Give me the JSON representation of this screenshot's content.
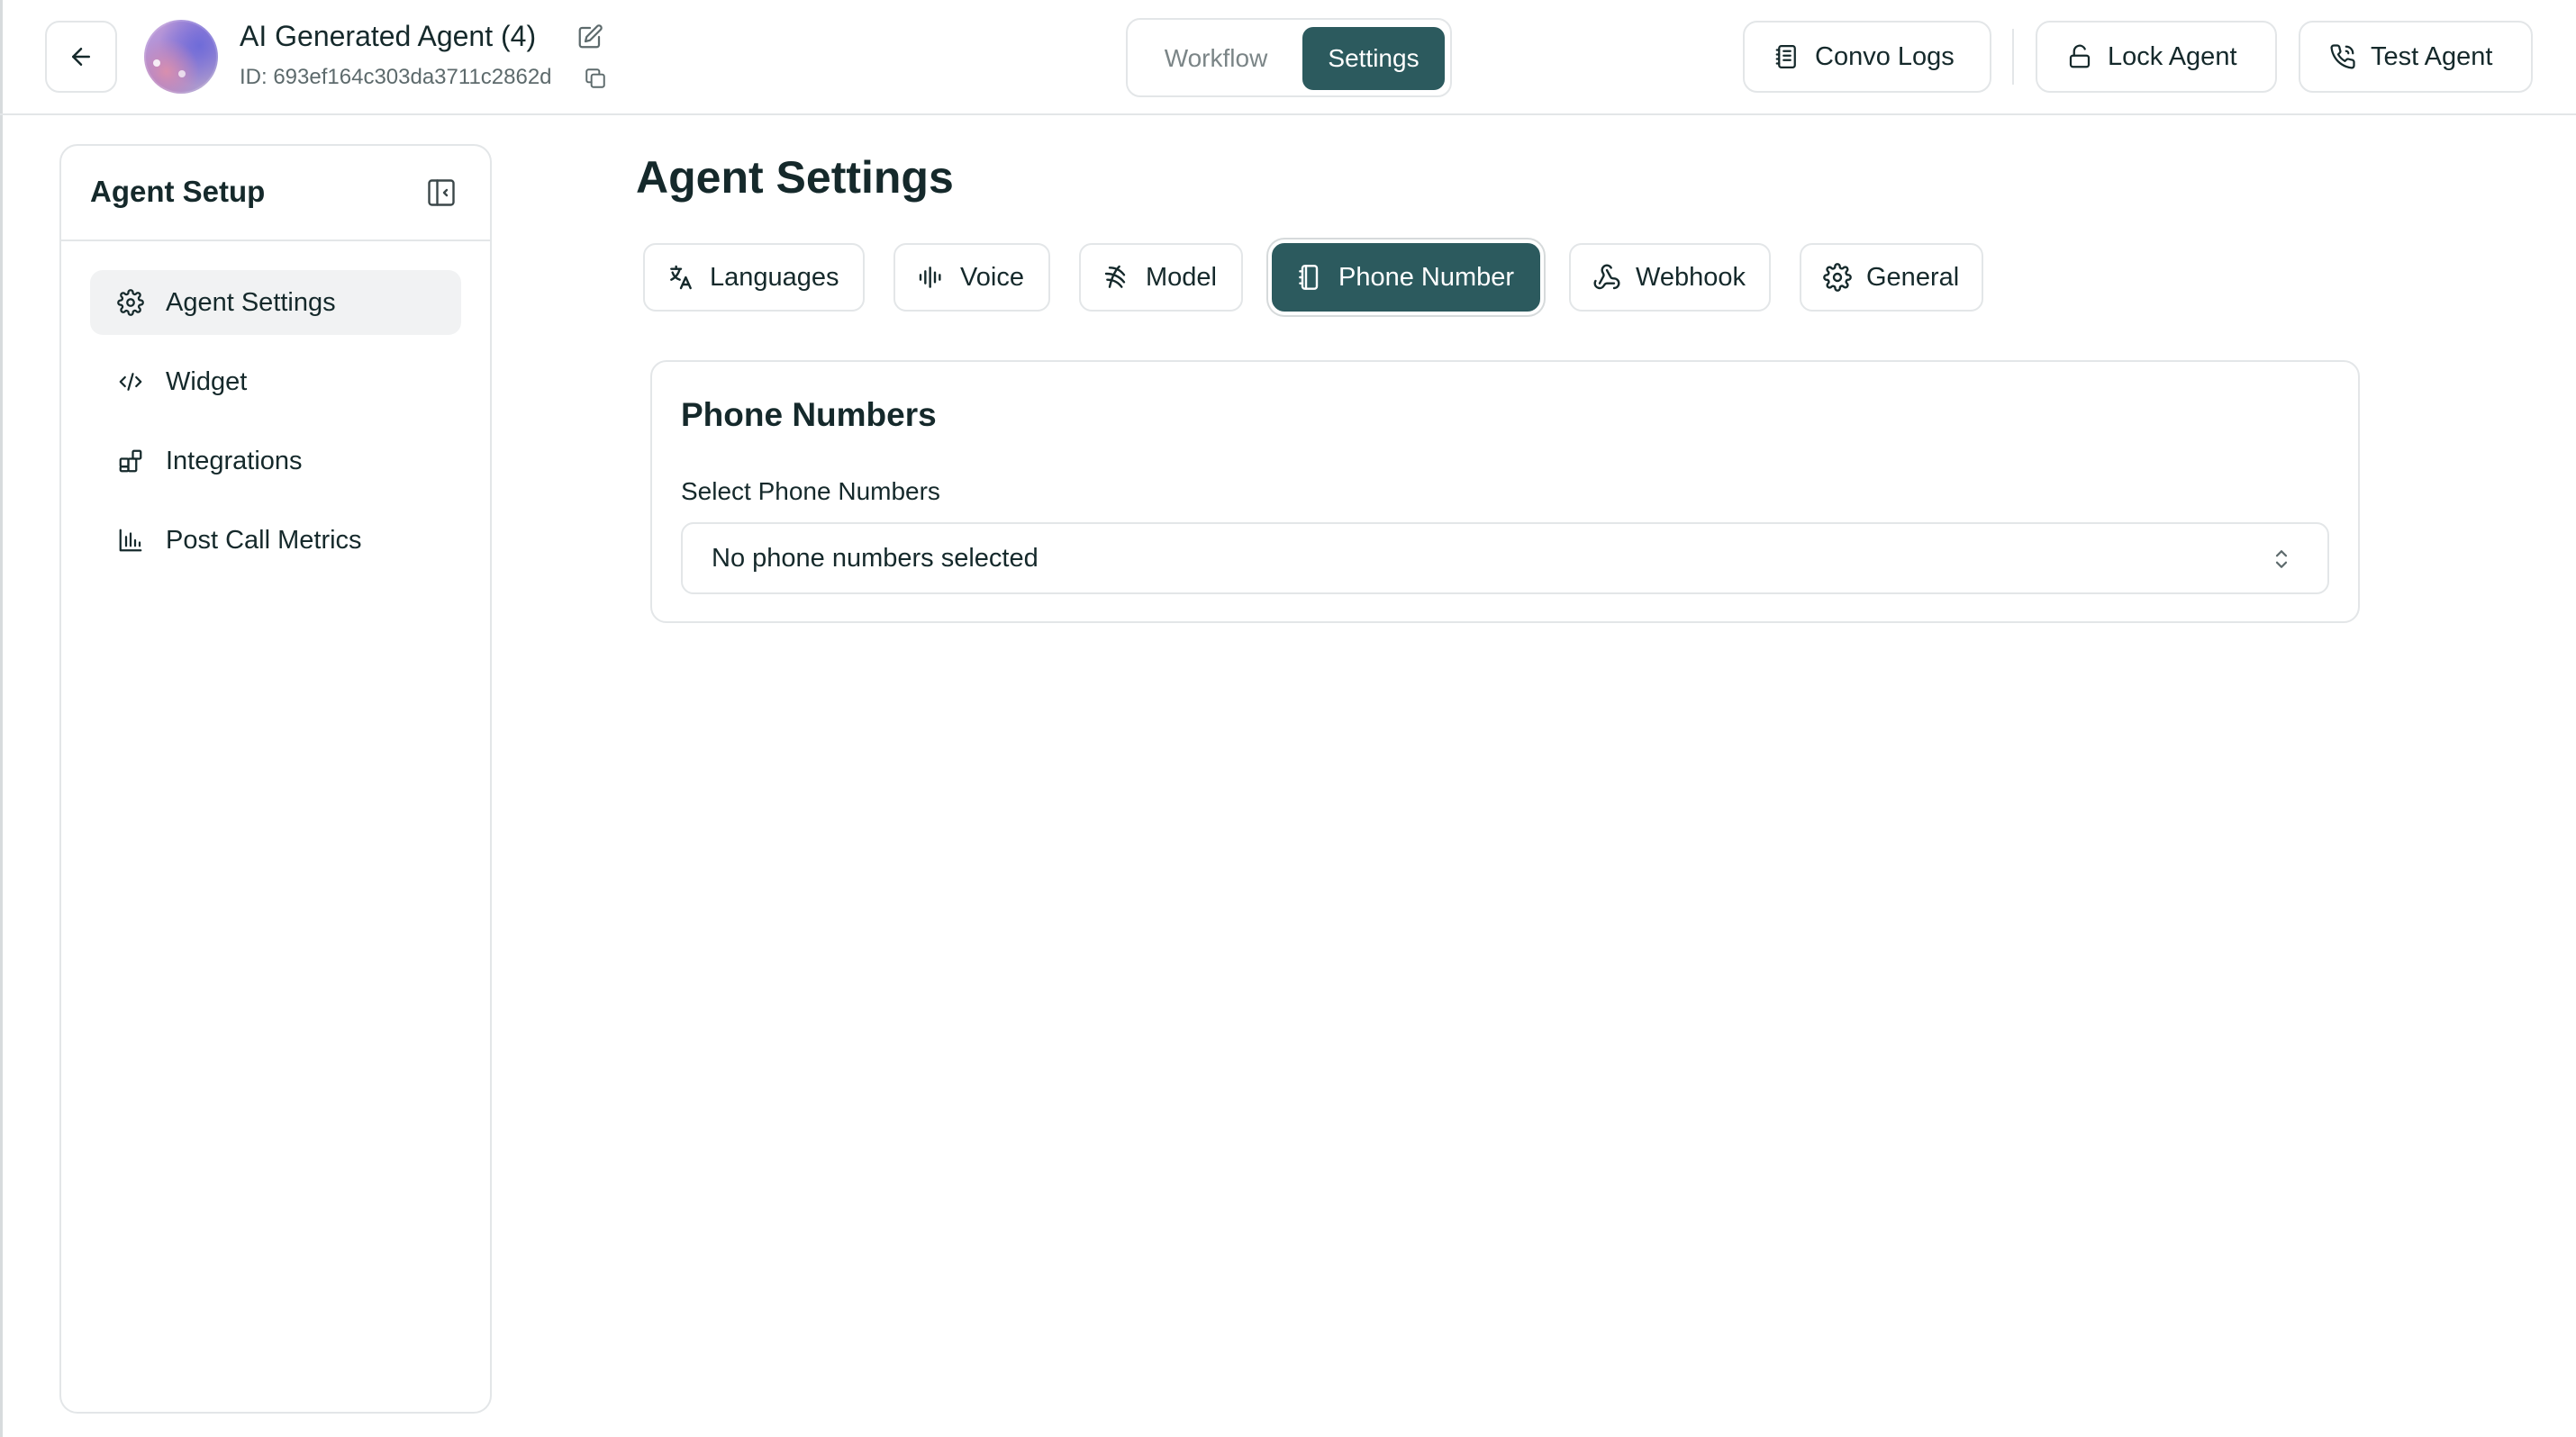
{
  "colors": {
    "accent": "#2c5a5e",
    "border": "#e3e6e8",
    "text": "#15292b"
  },
  "header": {
    "back_icon": "arrow-left-icon",
    "agent_name": "AI Generated Agent (4)",
    "agent_id": "ID: 693ef164c303da3711c2862d",
    "edit_icon": "pencil-square-icon",
    "copy_icon": "copy-icon",
    "view_toggle": {
      "workflow_label": "Workflow",
      "settings_label": "Settings",
      "selected": "Settings"
    },
    "actions": {
      "convo_logs_label": "Convo Logs",
      "lock_agent_label": "Lock Agent",
      "test_agent_label": "Test Agent"
    }
  },
  "sidebar": {
    "title": "Agent Setup",
    "collapse_icon": "sidebar-collapse-icon",
    "items": [
      {
        "label": "Agent Settings",
        "icon": "gear-icon",
        "active": true
      },
      {
        "label": "Widget",
        "icon": "code-icon",
        "active": false
      },
      {
        "label": "Integrations",
        "icon": "blocks-icon",
        "active": false
      },
      {
        "label": "Post Call Metrics",
        "icon": "bar-chart-icon",
        "active": false
      }
    ]
  },
  "main": {
    "title": "Agent Settings",
    "tabs": [
      {
        "label": "Languages",
        "icon": "translate-icon"
      },
      {
        "label": "Voice",
        "icon": "audio-waveform-icon"
      },
      {
        "label": "Model",
        "icon": "model-icon"
      },
      {
        "label": "Phone Number",
        "icon": "phone-device-icon",
        "active": true
      },
      {
        "label": "Webhook",
        "icon": "webhook-icon"
      },
      {
        "label": "General",
        "icon": "gear-icon"
      }
    ],
    "phone_card": {
      "title": "Phone Numbers",
      "field_label": "Select Phone Numbers",
      "select_value": "No phone numbers selected",
      "select_icon": "chevrons-up-down-icon"
    }
  }
}
